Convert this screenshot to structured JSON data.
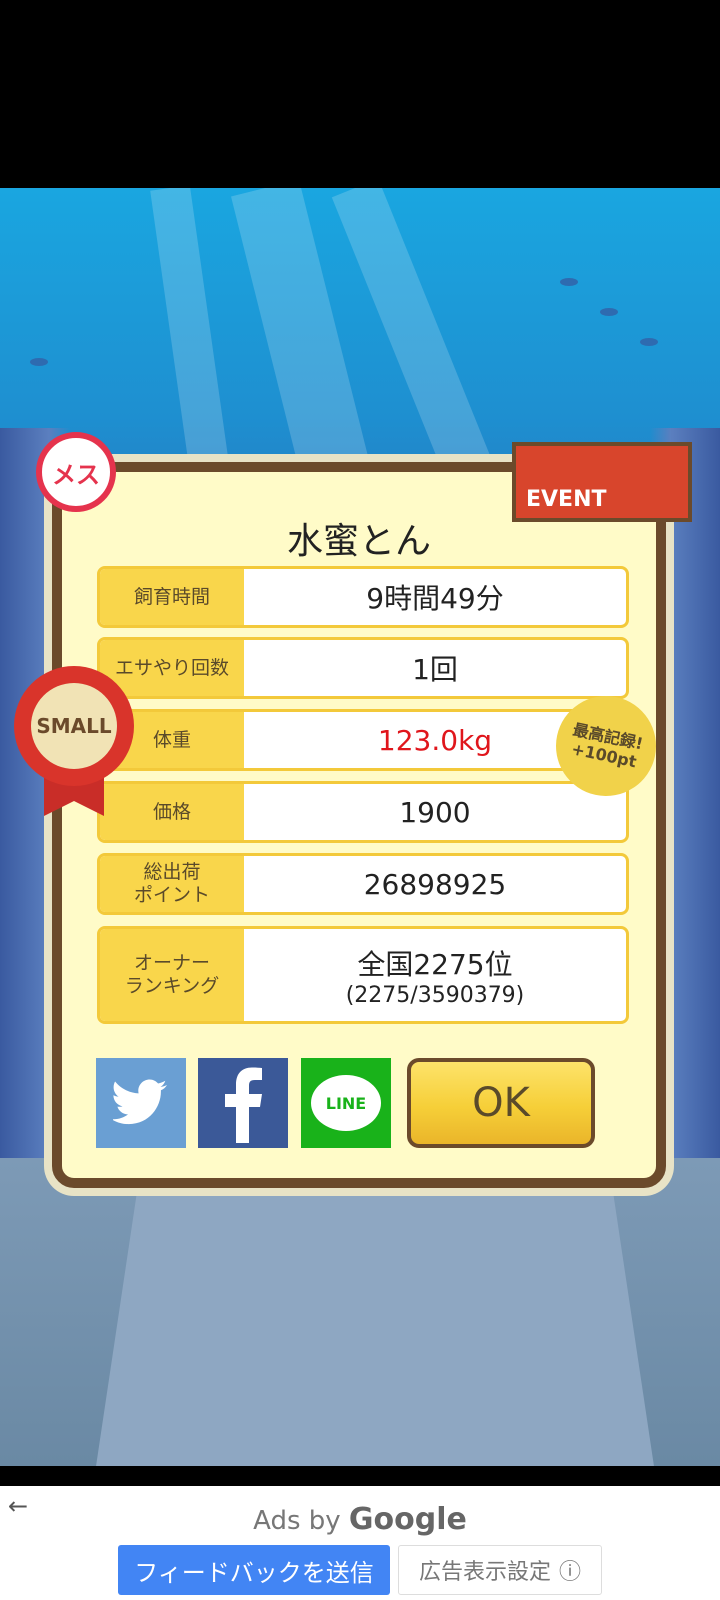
{
  "screen": {
    "pig_name": "水蜜とん",
    "stats": [
      {
        "label": "飼育時間",
        "value": "9時間49分",
        "highlight": false
      },
      {
        "label": "エサやり回数",
        "value": "1回",
        "highlight": false
      },
      {
        "label": "体重",
        "value": "123.0kg",
        "highlight": true
      },
      {
        "label": "価格",
        "value": "1900",
        "highlight": false
      },
      {
        "label": "総出荷\nポイント",
        "value": "26898925",
        "highlight": false
      }
    ],
    "ranking": {
      "label": "オーナー\nランキング",
      "value": "全国2275位",
      "sub": "(2275/3590379)"
    },
    "badges": {
      "female": "メス",
      "event": "EVENT",
      "size": "SMALL",
      "record_line1": "最高記録!",
      "record_line2": "+100pt"
    },
    "share": {
      "twitter_icon": "twitter-icon",
      "facebook_icon": "facebook-icon",
      "line_label": "LINE"
    },
    "ok_label": "OK"
  },
  "ads": {
    "ads_by": "Ads by",
    "google": "Google",
    "feedback_label": "フィードバックを送信",
    "settings_label": "広告表示設定",
    "info_icon": "ⓘ"
  },
  "colors": {
    "accent": "#f9d64b",
    "frame": "#6b4a2b",
    "red": "#e0161c",
    "ad_blue": "#4285f4"
  }
}
